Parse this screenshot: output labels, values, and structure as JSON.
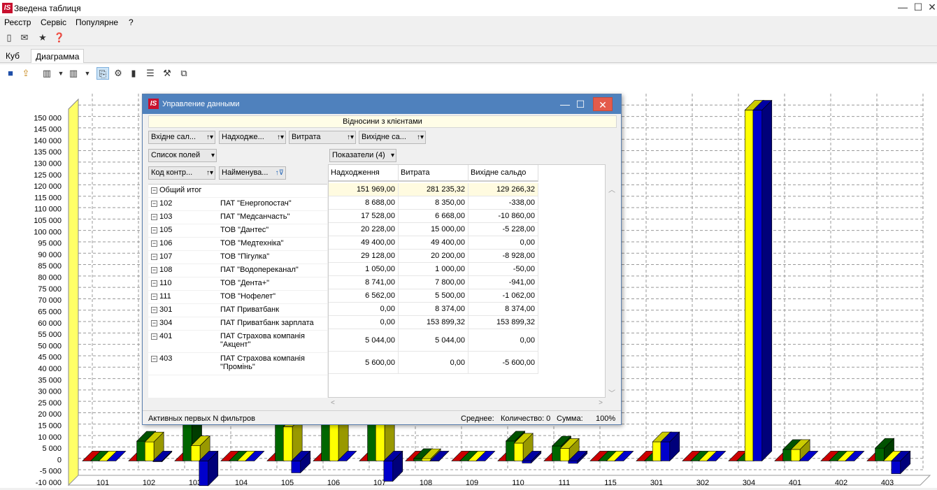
{
  "window": {
    "title": "Зведена таблиця",
    "logo": "IS",
    "minimize": "—",
    "maximize": "☐",
    "close": "✕"
  },
  "menu": [
    "Реєстр",
    "Сервіс",
    "Популярне",
    "?"
  ],
  "tabs": [
    {
      "label": "Куб"
    },
    {
      "label": "Диаграмма"
    }
  ],
  "chart_data": {
    "type": "bar",
    "ylim": [
      -10000,
      155000
    ],
    "y_ticks": [
      "150 000",
      "145 000",
      "140 000",
      "135 000",
      "130 000",
      "125 000",
      "120 000",
      "115 000",
      "110 000",
      "105 000",
      "100 000",
      "95 000",
      "90 000",
      "85 000",
      "80 000",
      "75 000",
      "70 000",
      "65 000",
      "60 000",
      "55 000",
      "50 000",
      "45 000",
      "40 000",
      "35 000",
      "30 000",
      "25 000",
      "20 000",
      "15 000",
      "10 000",
      "5 000",
      "0",
      "-5 000",
      "-10 000"
    ],
    "categories": [
      "101",
      "102",
      "103",
      "104",
      "105",
      "106",
      "107",
      "108",
      "109",
      "110",
      "111",
      "115",
      "301",
      "302",
      "304",
      "401",
      "402",
      "403"
    ],
    "series": [
      {
        "color": "#cc0000",
        "values": [
          0,
          0,
          0,
          0,
          0,
          0,
          0,
          0,
          0,
          0,
          0,
          0,
          0,
          0,
          0,
          0,
          0,
          0
        ]
      },
      {
        "color": "#006600",
        "values": [
          0,
          8688,
          17528,
          0,
          20228,
          49400,
          29128,
          1050,
          0,
          8741,
          6562,
          0,
          0,
          0,
          0,
          5044,
          0,
          5600
        ]
      },
      {
        "color": "#ffff00",
        "values": [
          0,
          8350,
          6668,
          0,
          15000,
          49400,
          20200,
          1000,
          0,
          7800,
          5500,
          0,
          8374,
          0,
          153899,
          5044,
          0,
          0
        ]
      },
      {
        "color": "#0000cc",
        "values": [
          0,
          -338,
          -10860,
          0,
          -5228,
          0,
          -8928,
          -50,
          0,
          -941,
          -1062,
          0,
          8374,
          0,
          153899,
          0,
          0,
          -5600
        ]
      }
    ]
  },
  "dialog": {
    "title": "Управление данными",
    "report_title": "Відносини з клієнтами",
    "filter_fields": [
      "Вхідне сал...",
      "Надходже...",
      "Витрата",
      "Вихідне са..."
    ],
    "field_list_label": "Список полей",
    "row_fields": [
      "Код контр...",
      "Найменува..."
    ],
    "measures_label": "Показатели (4)",
    "columns": [
      "Надходження",
      "Витрата",
      "Вихідне сальдо"
    ],
    "total_label": "Общий итог",
    "total": [
      "151 969,00",
      "281 235,32",
      "129 266,32"
    ],
    "rows": [
      {
        "code": "102",
        "name": "ПАТ \"Енергопостач\"",
        "v": [
          "8 688,00",
          "8 350,00",
          "-338,00"
        ]
      },
      {
        "code": "103",
        "name": "ПАТ \"Медсанчасть\"",
        "v": [
          "17 528,00",
          "6 668,00",
          "-10 860,00"
        ]
      },
      {
        "code": "105",
        "name": "ТОВ \"Дантес\"",
        "v": [
          "20 228,00",
          "15 000,00",
          "-5 228,00"
        ]
      },
      {
        "code": "106",
        "name": "ТОВ \"Медтехніка\"",
        "v": [
          "49 400,00",
          "49 400,00",
          "0,00"
        ]
      },
      {
        "code": "107",
        "name": "ТОВ \"Пігулка\"",
        "v": [
          "29 128,00",
          "20 200,00",
          "-8 928,00"
        ]
      },
      {
        "code": "108",
        "name": "ПАТ \"Водопереканал\"",
        "v": [
          "1 050,00",
          "1 000,00",
          "-50,00"
        ]
      },
      {
        "code": "110",
        "name": "ТОВ \"Дента+\"",
        "v": [
          "8 741,00",
          "7 800,00",
          "-941,00"
        ]
      },
      {
        "code": "111",
        "name": "ТОВ \"Нофелет\"",
        "v": [
          "6 562,00",
          "5 500,00",
          "-1 062,00"
        ]
      },
      {
        "code": "301",
        "name": "ПАТ Приватбанк",
        "v": [
          "0,00",
          "8 374,00",
          "8 374,00"
        ]
      },
      {
        "code": "304",
        "name": "ПАТ Приватбанк зарплата",
        "v": [
          "0,00",
          "153 899,32",
          "153 899,32"
        ]
      },
      {
        "code": "401",
        "name": "ПАТ Страхова компанія \"Акцент\"",
        "v": [
          "5 044,00",
          "5 044,00",
          "0,00"
        ]
      },
      {
        "code": "403",
        "name": "ПАТ Страхова компанія \"Промінь\"",
        "v": [
          "5 600,00",
          "0,00",
          "-5 600,00"
        ]
      }
    ],
    "status": {
      "filters": "Активных первых N фильтров",
      "average": "Среднее:",
      "count": "Количество: 0",
      "sum": "Сумма:",
      "zoom": "100%"
    }
  }
}
